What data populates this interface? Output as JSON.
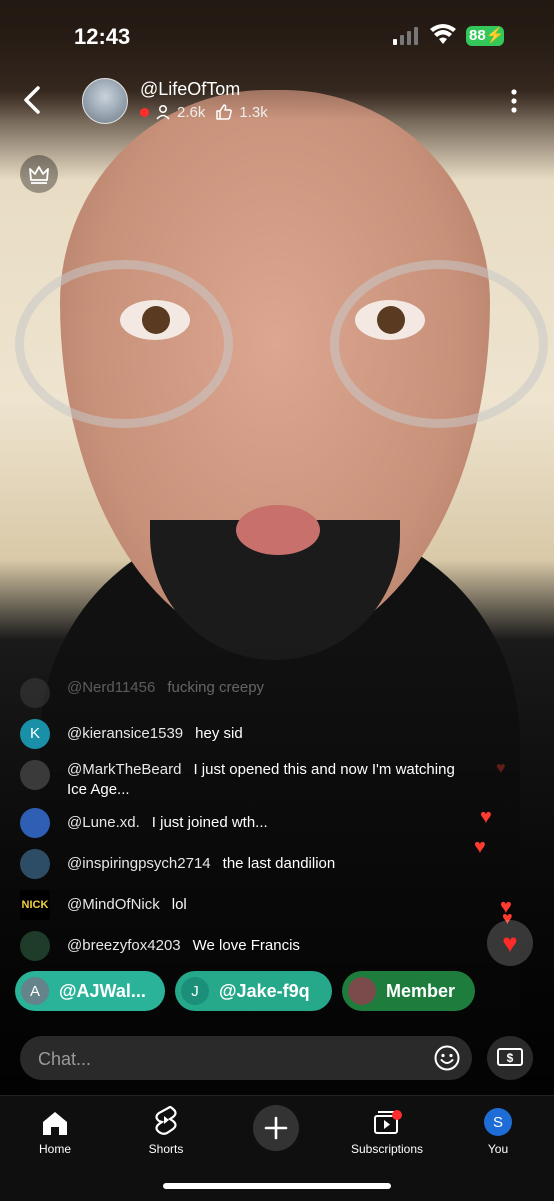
{
  "status": {
    "time": "12:43",
    "battery": "88"
  },
  "header": {
    "channel": "@LifeOfTom",
    "viewers": "2.6k",
    "likes": "1.3k"
  },
  "chat": {
    "messages": [
      {
        "avatar_letter": "",
        "user": "@Nerd11456",
        "text": "fucking creepy",
        "avatar_color": "#555555"
      },
      {
        "avatar_letter": "K",
        "user": "@kieransice1539",
        "text": "hey sid",
        "avatar_color": "#1a8fa8"
      },
      {
        "avatar_letter": "",
        "user": "@MarkTheBeard",
        "text": "I just opened this and now I'm watching Ice Age...",
        "avatar_color": "#3a3a3a"
      },
      {
        "avatar_letter": "",
        "user": "@Lune.xd.",
        "text": "I just joined wth...",
        "avatar_color": "#2f5fb5"
      },
      {
        "avatar_letter": "",
        "user": "@inspiringpsych2714",
        "text": "the last dandilion",
        "avatar_color": "#2d4d66"
      },
      {
        "avatar_letter": "NICK",
        "user": "@MindOfNick",
        "text": "lol",
        "avatar_color": "#000000"
      },
      {
        "avatar_letter": "",
        "user": "@breezyfox4203",
        "text": "We love Francis",
        "avatar_color": "#1f3b2a"
      }
    ],
    "placeholder": "Chat..."
  },
  "chips": [
    {
      "initial": "A",
      "label": "@AJWal..."
    },
    {
      "initial": "J",
      "label": "@Jake-f9q"
    },
    {
      "initial": "",
      "label": "Member"
    }
  ],
  "nav": {
    "home": "Home",
    "shorts": "Shorts",
    "subscriptions": "Subscriptions",
    "you": "You",
    "you_initial": "S"
  },
  "colors": {
    "live": "#ff2d2d",
    "battery": "#34c759",
    "chip_member": "#1e7d3d",
    "chip_user": "#2bb39a",
    "heart": "#ff3b30"
  },
  "icons": [
    "back-icon",
    "more-vert-icon",
    "crown-icon",
    "person-icon",
    "thumbs-up-icon",
    "emoji-icon",
    "super-chat-icon",
    "home-icon",
    "shorts-icon",
    "add-icon",
    "subscriptions-icon",
    "heart-icon"
  ]
}
